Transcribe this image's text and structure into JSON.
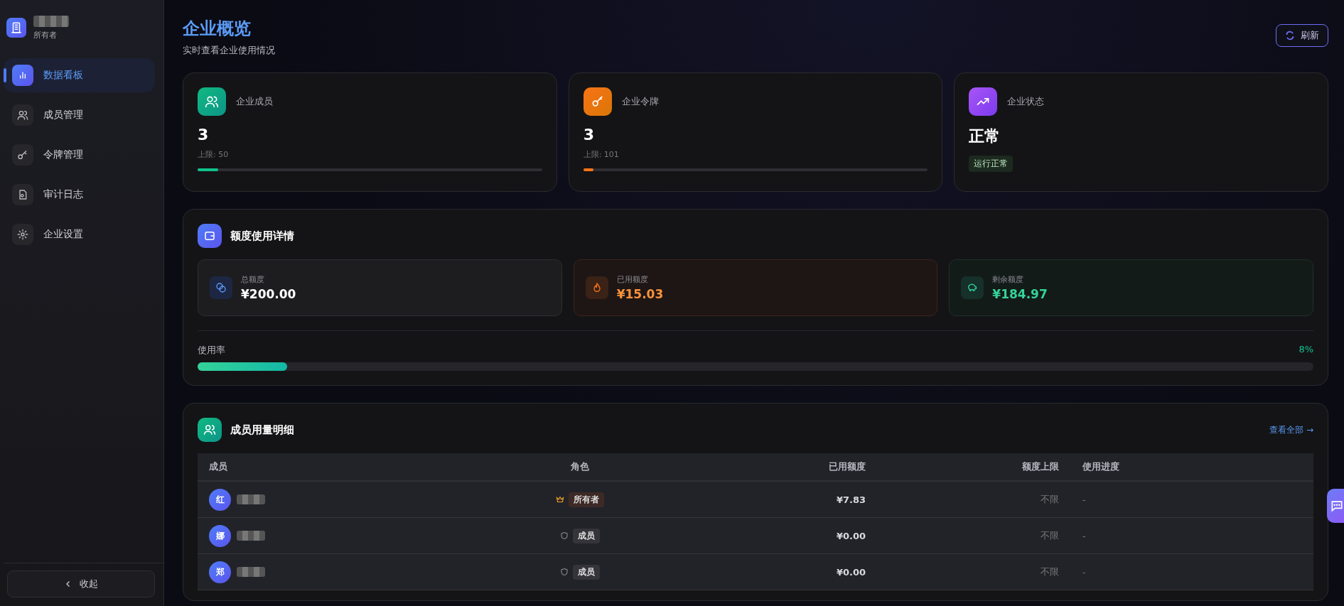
{
  "sidebar": {
    "role": "所有者",
    "items": [
      {
        "label": "数据看板",
        "kind": "chart",
        "selected": true
      },
      {
        "label": "成员管理",
        "kind": "users",
        "selected": false
      },
      {
        "label": "令牌管理",
        "kind": "key",
        "selected": false
      },
      {
        "label": "审计日志",
        "kind": "doc",
        "selected": false
      },
      {
        "label": "企业设置",
        "kind": "gear",
        "selected": false
      }
    ],
    "collapse": "收起"
  },
  "header": {
    "title": "企业概览",
    "subtitle": "实时查看企业使用情况",
    "refresh": "刷新"
  },
  "stats": [
    {
      "kind": "members",
      "label": "企业成员",
      "value": "3",
      "limit": "上限: 50",
      "level": 0.06
    },
    {
      "kind": "tokens",
      "label": "企业令牌",
      "value": "3",
      "limit": "上限: 101",
      "level": 0.03
    },
    {
      "kind": "status",
      "label": "企业状态",
      "value": "正常",
      "badge": "运行正常"
    }
  ],
  "quota": {
    "title": "额度使用详情",
    "items": [
      {
        "kind": "total",
        "label": "总额度",
        "value": "¥200.00"
      },
      {
        "kind": "used",
        "label": "已用额度",
        "value": "¥15.03"
      },
      {
        "kind": "remaining",
        "label": "剩余额度",
        "value": "¥184.97"
      }
    ],
    "rate_label": "使用率",
    "rate": "8%",
    "level": 0.08
  },
  "members": {
    "title": "成员用量明细",
    "view_all": "查看全部 →",
    "columns": [
      "成员",
      "角色",
      "已用额度",
      "额度上限",
      "使用进度"
    ],
    "rows": [
      {
        "initial": "红",
        "kind": "owner",
        "role": "所有者",
        "used": "¥7.83",
        "limit": "不限",
        "progress": "-"
      },
      {
        "initial": "娜",
        "kind": "member",
        "role": "成员",
        "used": "¥0.00",
        "limit": "不限",
        "progress": "-"
      },
      {
        "initial": "郑",
        "kind": "member",
        "role": "成员",
        "used": "¥0.00",
        "limit": "不限",
        "progress": "-"
      }
    ]
  }
}
